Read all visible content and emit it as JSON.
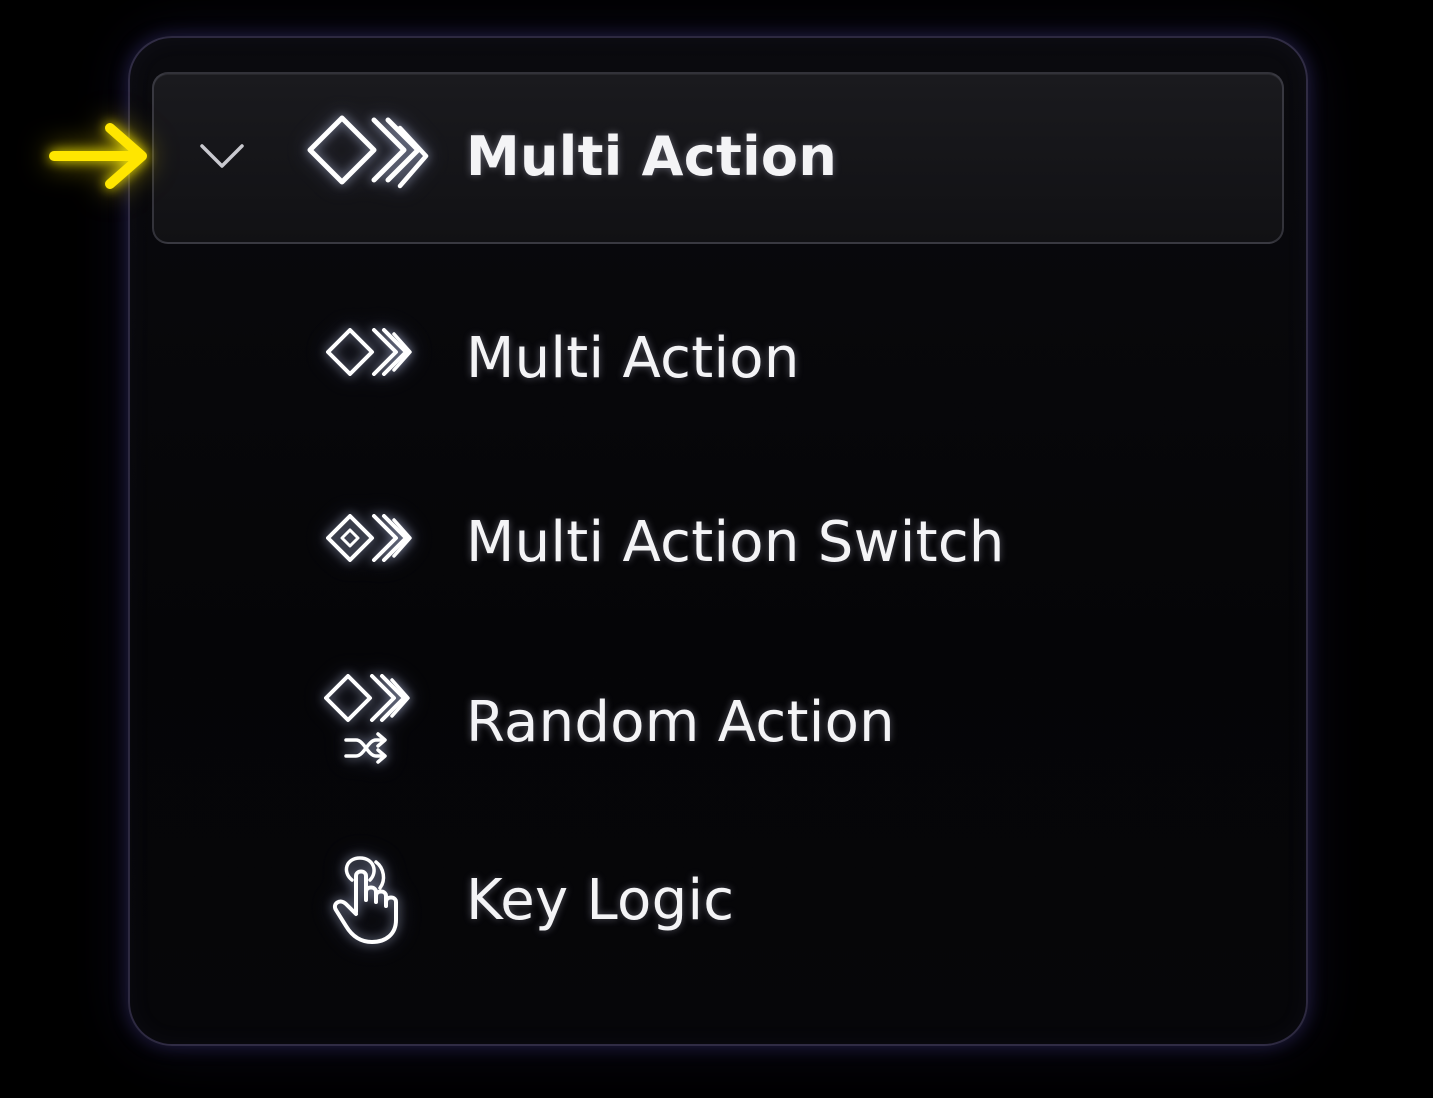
{
  "menu": {
    "header": {
      "label": "Multi Action",
      "icon": "multi-action-icon",
      "expand_icon": "chevron-down-icon",
      "expanded": true
    },
    "items": [
      {
        "label": "Multi Action",
        "icon": "multi-action-icon"
      },
      {
        "label": "Multi Action Switch",
        "icon": "multi-action-switch-icon"
      },
      {
        "label": "Random Action",
        "icon": "random-action-icon"
      },
      {
        "label": "Key Logic",
        "icon": "key-logic-icon"
      }
    ]
  },
  "annotation": {
    "pointer_icon": "arrow-right-icon",
    "pointer_color": "#FFE600"
  },
  "colors": {
    "background": "#000000",
    "panel_glow": "#5A50B4",
    "text": "#F4F4F6"
  }
}
